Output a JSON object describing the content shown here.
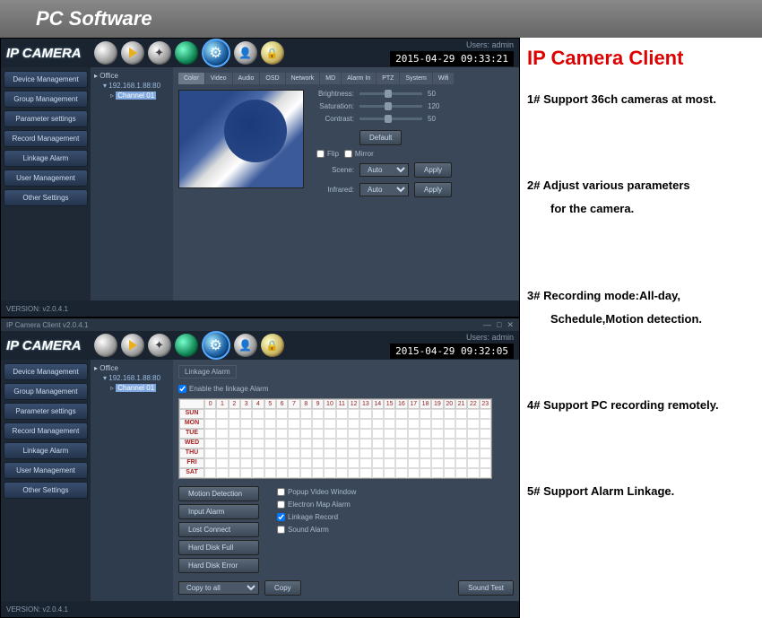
{
  "banner": "PC Software",
  "right": {
    "title": "IP Camera Client",
    "features": [
      {
        "num": "1#",
        "text": "Support 36ch cameras at most."
      },
      {
        "num": "2#",
        "text": "Adjust various parameters",
        "sub": "for the camera."
      },
      {
        "num": "3#",
        "text": "Recording mode:All-day,",
        "sub": "Schedule,Motion detection."
      },
      {
        "num": "4#",
        "text": "Support PC recording remotely."
      },
      {
        "num": "5#",
        "text": "Support Alarm Linkage."
      }
    ]
  },
  "app1": {
    "logo": "IP CAMERA",
    "users_label": "Users: admin",
    "datetime": "2015-04-29 09:33:21",
    "sidebar": [
      "Device Management",
      "Group Management",
      "Parameter settings",
      "Record Management",
      "Linkage Alarm",
      "User Management",
      "Other Settings"
    ],
    "tree": {
      "root": "Office",
      "ip": "192.168.1.88:80",
      "channel": "Channel 01"
    },
    "tabs": [
      "Color",
      "Video",
      "Audio",
      "OSD",
      "Network",
      "MD",
      "Alarm In",
      "PTZ",
      "System",
      "Wifi"
    ],
    "active_tab": 0,
    "ctrl": {
      "brightness_label": "Brightness:",
      "brightness_val": "50",
      "saturation_label": "Saturation:",
      "saturation_val": "120",
      "contrast_label": "Contrast:",
      "contrast_val": "50",
      "default_btn": "Default",
      "flip": "Flip",
      "mirror": "Mirror",
      "scene_label": "Scene:",
      "scene_val": "Auto",
      "apply": "Apply",
      "infrared_label": "Infrared:",
      "infrared_val": "Auto"
    },
    "version": "VERSION: v2.0.4.1"
  },
  "app2": {
    "titlebar": "IP Camera Client v2.0.4.1",
    "logo": "IP CAMERA",
    "users_label": "Users: admin",
    "datetime": "2015-04-29 09:32:05",
    "sidebar": [
      "Device Management",
      "Group Management",
      "Parameter settings",
      "Record Management",
      "Linkage Alarm",
      "User Management",
      "Other Settings"
    ],
    "tree": {
      "root": "Office",
      "ip": "192.168.1.88:80",
      "channel": "Channel 01"
    },
    "linkage": {
      "panel_title": "Linkage Alarm",
      "enable": "Enable the linkage Alarm",
      "hours": [
        "0",
        "1",
        "2",
        "3",
        "4",
        "5",
        "6",
        "7",
        "8",
        "9",
        "10",
        "11",
        "12",
        "13",
        "14",
        "15",
        "16",
        "17",
        "18",
        "19",
        "20",
        "21",
        "22",
        "23"
      ],
      "days": [
        "SUN",
        "MON",
        "TUE",
        "WED",
        "THU",
        "FRI",
        "SAT"
      ],
      "btns": [
        "Motion Detection",
        "Input Alarm",
        "Lost Connect",
        "Hard Disk Full",
        "Hard Disk Error"
      ],
      "chks": [
        "Popup Video Window",
        "Electron Map Alarm",
        "Linkage Record",
        "Sound Alarm"
      ],
      "copy_to": "Copy to all",
      "copy_btn": "Copy",
      "sound_test": "Sound Test"
    },
    "version": "VERSION: v2.0.4.1"
  }
}
